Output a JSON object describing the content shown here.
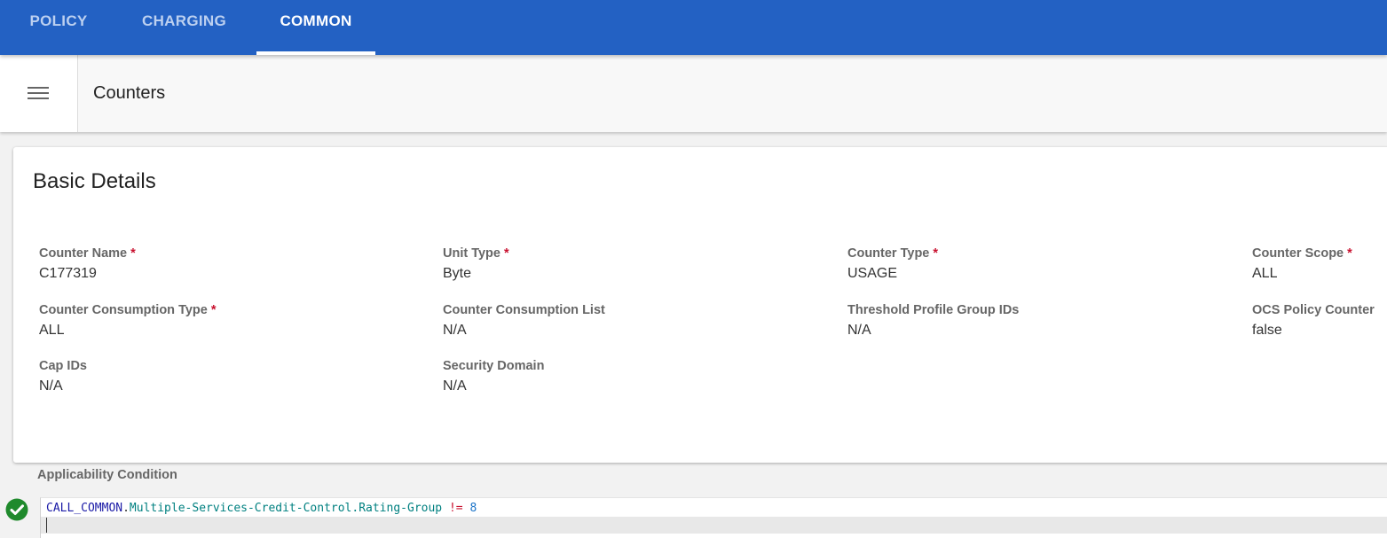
{
  "nav": {
    "tabs": [
      {
        "label": "POLICY",
        "active": false
      },
      {
        "label": "CHARGING",
        "active": false
      },
      {
        "label": "COMMON",
        "active": true
      }
    ]
  },
  "toolbar": {
    "menu_icon": "hamburger-menu-icon",
    "title": "Counters"
  },
  "card": {
    "title": "Basic Details",
    "fields": [
      {
        "label": "Counter Name",
        "value": "C177319",
        "required": true
      },
      {
        "label": "Unit Type",
        "value": "Byte",
        "required": true
      },
      {
        "label": "Counter Type",
        "value": "USAGE",
        "required": true
      },
      {
        "label": "Counter Scope",
        "value": "ALL",
        "required": true
      },
      {
        "label": "Counter Consumption Type",
        "value": "ALL",
        "required": true
      },
      {
        "label": "Counter Consumption List",
        "value": "N/A",
        "required": false
      },
      {
        "label": "Threshold Profile Group IDs",
        "value": "N/A",
        "required": false
      },
      {
        "label": "OCS Policy Counter",
        "value": "false",
        "required": false
      },
      {
        "label": "Cap IDs",
        "value": "N/A",
        "required": false
      },
      {
        "label": "Security Domain",
        "value": "N/A",
        "required": false
      }
    ],
    "required_marker": "*"
  },
  "condition": {
    "label": "Applicability Condition",
    "status_icon": "check-circle-icon",
    "code": {
      "object": "CALL_COMMON",
      "dot": ".",
      "path": "Multiple-Services-Credit-Control.Rating-Group",
      "operator": "!=",
      "value": "8"
    }
  },
  "colors": {
    "nav_bg": "#2361c3",
    "required": "#c8102e",
    "valid": "#1f8a2c",
    "code_object": "#1a1aa6",
    "code_path": "#008080",
    "code_operator": "#c8102e",
    "code_number": "#1a73c8"
  }
}
